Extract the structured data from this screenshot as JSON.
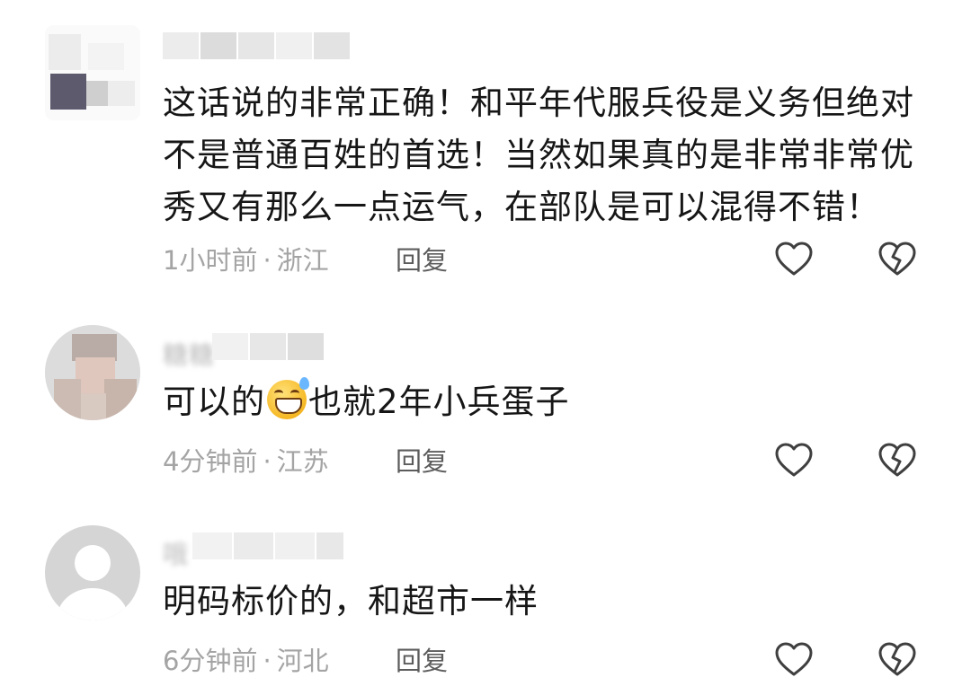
{
  "comments": [
    {
      "text": "这话说的非常正确！和平年代服兵役是义务但绝对不是普通百姓的首选！当然如果真的是非常非常优秀又有那么一点运气，在部队是可以混得不错！",
      "time": "1小时前",
      "separator": "·",
      "location": "浙江",
      "reply_label": "回复"
    },
    {
      "username_partial": "糖糖",
      "text_before_emoji": "可以的",
      "emoji": "grinning-sweat-emoji",
      "text_after_emoji": "也就2年小兵蛋子",
      "time": "4分钟前",
      "separator": "·",
      "location": "江苏",
      "reply_label": "回复"
    },
    {
      "username_partial": "哦",
      "text": "明码标价的，和超市一样",
      "time": "6分钟前",
      "separator": "·",
      "location": "河北",
      "reply_label": "回复"
    }
  ],
  "icons": {
    "like": "heart-icon",
    "dislike": "broken-heart-icon"
  },
  "colors": {
    "text": "#161616",
    "meta": "#a4a4a4",
    "reply": "#5c5c5c",
    "icon_stroke": "#3f3f3f"
  }
}
